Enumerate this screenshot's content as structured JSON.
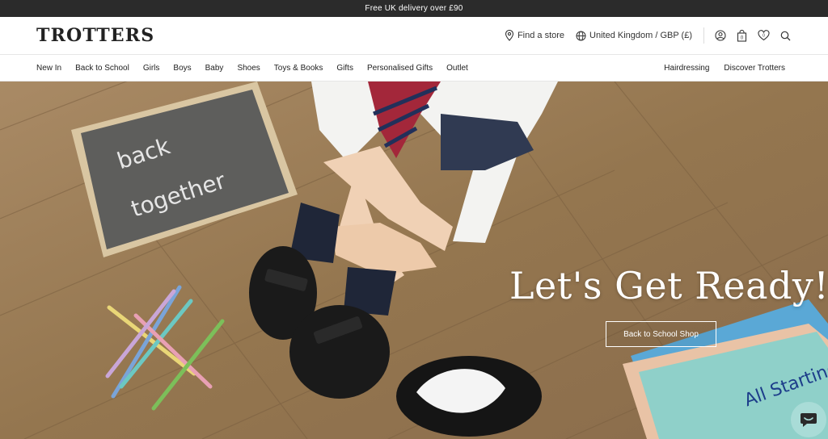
{
  "promo": {
    "text": "Free UK delivery over £90"
  },
  "header": {
    "logo": "TROTTERS",
    "find_store": "Find a store",
    "locale": "United Kingdom / GBP (£)",
    "icons": [
      "account-icon",
      "bag-icon",
      "wishlist-icon",
      "search-icon"
    ]
  },
  "nav": {
    "left": [
      "New In",
      "Back to School",
      "Girls",
      "Boys",
      "Baby",
      "Shoes",
      "Toys & Books",
      "Gifts",
      "Personalised Gifts",
      "Outlet"
    ],
    "right": [
      "Hairdressing",
      "Discover Trotters"
    ]
  },
  "hero": {
    "title": "Let's Get Ready!",
    "cta": "Back to School Shop",
    "chalkboard_text": [
      "back",
      "together"
    ],
    "book_text": "All Starting School"
  },
  "colors": {
    "promo_bg": "#2b2b2b",
    "floor": "#9c7d5a",
    "chat_button": "#a9dcd7"
  }
}
